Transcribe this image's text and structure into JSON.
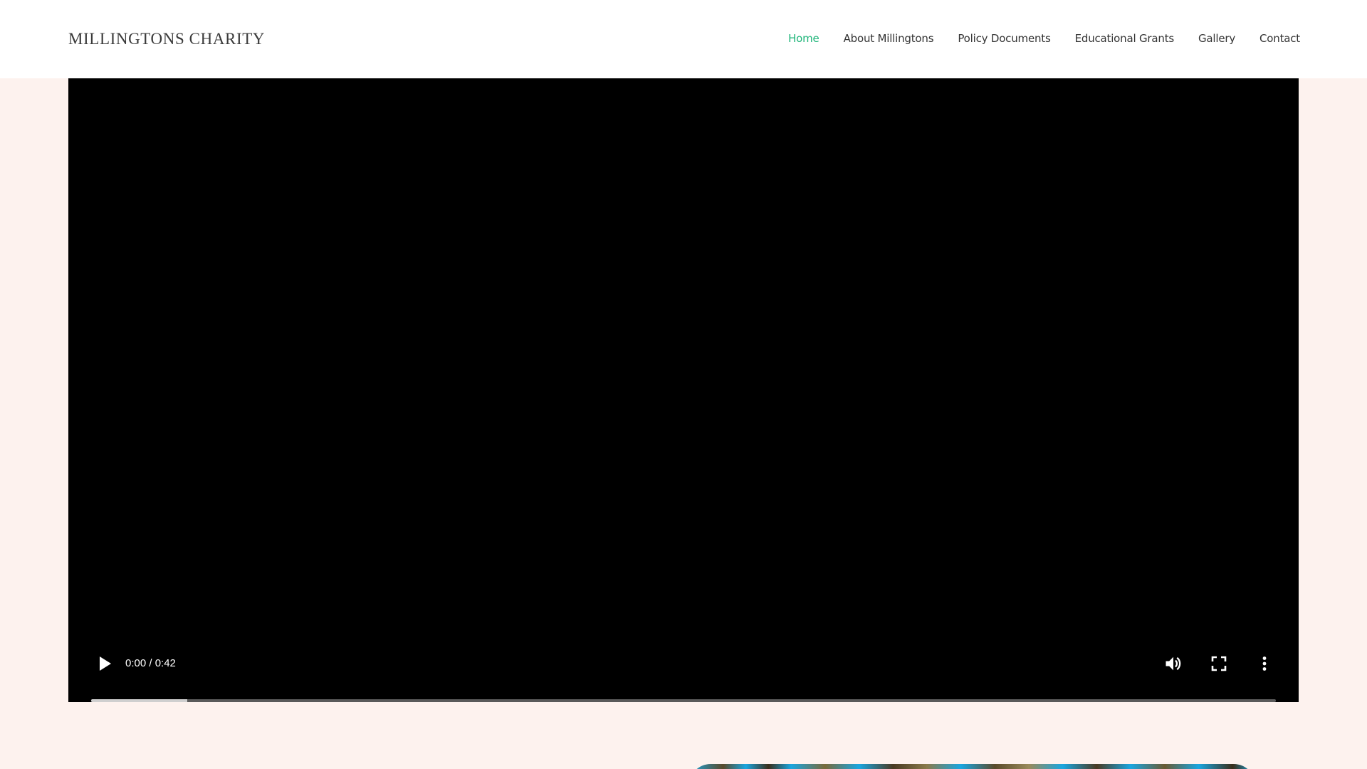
{
  "site": {
    "logo": "MILLINGTONS CHARITY"
  },
  "nav": {
    "items": [
      {
        "label": "Home",
        "active": true
      },
      {
        "label": "About Millingtons",
        "active": false
      },
      {
        "label": "Policy Documents",
        "active": false
      },
      {
        "label": "Educational Grants",
        "active": false
      },
      {
        "label": "Gallery",
        "active": false
      },
      {
        "label": "Contact",
        "active": false
      }
    ],
    "active_color": "#1fb57a"
  },
  "video": {
    "time_display": "0:00 / 0:42",
    "buffered_fraction": 0.081,
    "icons": [
      "play-icon",
      "volume-icon",
      "fullscreen-icon",
      "more-options-icon"
    ]
  },
  "colors": {
    "page_background": "#fdf2ee",
    "header_background": "#ffffff",
    "video_background": "#000000"
  }
}
